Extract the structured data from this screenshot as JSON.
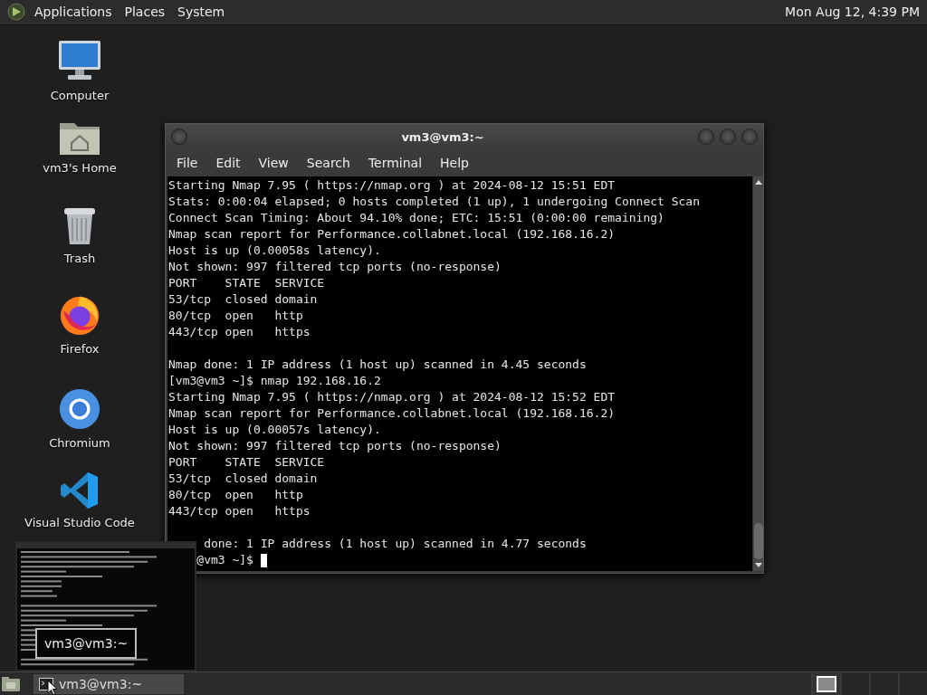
{
  "top_panel": {
    "menus": [
      "Applications",
      "Places",
      "System"
    ],
    "clock": "Mon Aug 12,  4:39 PM"
  },
  "desktop_icons": [
    {
      "kind": "computer",
      "label": "Computer"
    },
    {
      "kind": "home",
      "label": "vm3's Home"
    },
    {
      "kind": "trash",
      "label": "Trash"
    },
    {
      "kind": "firefox",
      "label": "Firefox"
    },
    {
      "kind": "chromium",
      "label": "Chromium"
    },
    {
      "kind": "vscode",
      "label": "Visual Studio Code"
    }
  ],
  "terminal": {
    "title": "vm3@vm3:~",
    "menu": [
      "File",
      "Edit",
      "View",
      "Search",
      "Terminal",
      "Help"
    ],
    "lines": [
      {
        "kind": "text",
        "text": "Starting Nmap 7.95 ( https://nmap.org ) at 2024-08-12 15:51 EDT"
      },
      {
        "kind": "text",
        "text": "Stats: 0:00:04 elapsed; 0 hosts completed (1 up), 1 undergoing Connect Scan"
      },
      {
        "kind": "text",
        "text": "Connect Scan Timing: About 94.10% done; ETC: 15:51 (0:00:00 remaining)"
      },
      {
        "kind": "text",
        "text": "Nmap scan report for Performance.collabnet.local (192.168.16.2)"
      },
      {
        "kind": "text",
        "text": "Host is up (0.00058s latency)."
      },
      {
        "kind": "text",
        "text": "Not shown: 997 filtered tcp ports (no-response)"
      },
      {
        "kind": "text",
        "text": "PORT    STATE  SERVICE"
      },
      {
        "kind": "text",
        "text": "53/tcp  closed domain"
      },
      {
        "kind": "text",
        "text": "80/tcp  open   http"
      },
      {
        "kind": "text",
        "text": "443/tcp open   https"
      },
      {
        "kind": "blank"
      },
      {
        "kind": "text",
        "text": "Nmap done: 1 IP address (1 host up) scanned in 4.45 seconds"
      },
      {
        "kind": "text",
        "text": "[vm3@vm3 ~]$ nmap 192.168.16.2"
      },
      {
        "kind": "text",
        "text": "Starting Nmap 7.95 ( https://nmap.org ) at 2024-08-12 15:52 EDT"
      },
      {
        "kind": "text",
        "text": "Nmap scan report for Performance.collabnet.local (192.168.16.2)"
      },
      {
        "kind": "text",
        "text": "Host is up (0.00057s latency)."
      },
      {
        "kind": "text",
        "text": "Not shown: 997 filtered tcp ports (no-response)"
      },
      {
        "kind": "text",
        "text": "PORT    STATE  SERVICE"
      },
      {
        "kind": "text",
        "text": "53/tcp  closed domain"
      },
      {
        "kind": "text",
        "text": "80/tcp  open   http"
      },
      {
        "kind": "text",
        "text": "443/tcp open   https"
      },
      {
        "kind": "blank"
      },
      {
        "kind": "text",
        "text": "     done: 1 IP address (1 host up) scanned in 4.77 seconds"
      },
      {
        "kind": "prompt",
        "text": "    @vm3 ~]$"
      }
    ]
  },
  "window_preview": {
    "label": "vm3@vm3:~"
  },
  "taskbar": {
    "tasks": [
      {
        "label": "vm3@vm3:~",
        "selected": true
      }
    ],
    "workspaces": [
      {
        "selected": true
      },
      {
        "selected": false
      },
      {
        "selected": false
      },
      {
        "selected": false
      }
    ]
  }
}
